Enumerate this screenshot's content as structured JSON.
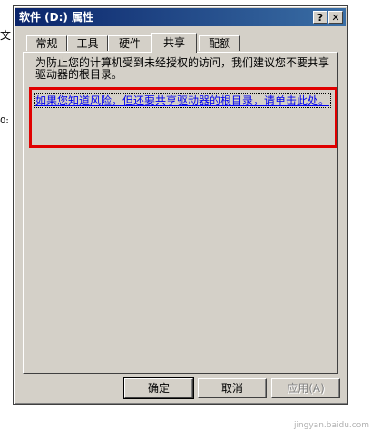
{
  "background": {
    "edge_text_1": "文",
    "edge_text_2": "0:"
  },
  "window": {
    "title": "软件 (D:) 属性",
    "help_label": "?",
    "close_label": "✕"
  },
  "tabs": [
    {
      "label": "常规",
      "active": false
    },
    {
      "label": "工具",
      "active": false
    },
    {
      "label": "硬件",
      "active": false
    },
    {
      "label": "共享",
      "active": true
    },
    {
      "label": "配额",
      "active": false
    }
  ],
  "share_panel": {
    "notice": "为防止您的计算机受到未经授权的访问，我们建议您不要共享驱动器的根目录。",
    "link": "如果您知道风险，但还要共享驱动器的根目录，请单击此处。",
    "highlight_color": "#e00000",
    "link_color": "#0000ee"
  },
  "buttons": {
    "ok": "确定",
    "cancel": "取消",
    "apply": "应用(A)"
  },
  "watermark": "jingyan.baidu.com"
}
